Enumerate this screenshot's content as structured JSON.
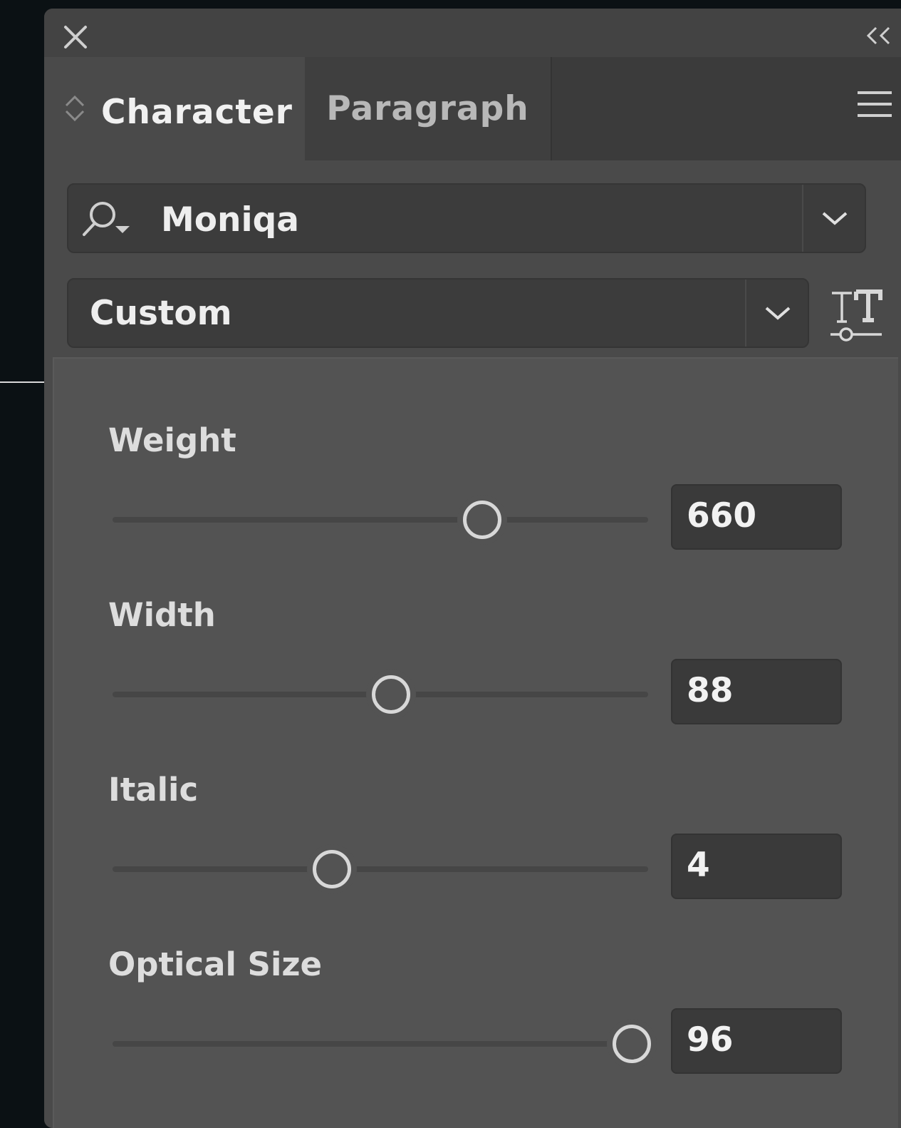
{
  "panel": {
    "tabs": [
      {
        "label": "Character",
        "active": true
      },
      {
        "label": "Paragraph",
        "active": false
      }
    ]
  },
  "font": {
    "family": "Moniqa",
    "style": "Custom"
  },
  "axes": [
    {
      "label": "Weight",
      "value": "660",
      "position": 0.69
    },
    {
      "label": "Width",
      "value": "88",
      "position": 0.52
    },
    {
      "label": "Italic",
      "value": "4",
      "position": 0.41
    },
    {
      "label": "Optical Size",
      "value": "96",
      "position": 0.97
    }
  ],
  "icons": {
    "close": "close-icon",
    "collapse": "double-chevron-left-icon",
    "menu": "hamburger-menu-icon",
    "search": "search-icon",
    "dropdown": "chevron-down-icon",
    "variable_font": "variable-font-icon"
  },
  "colors": {
    "background": "#0b1114",
    "panel": "#434343",
    "field": "#3c3c3c",
    "text": "#eeeeee"
  }
}
